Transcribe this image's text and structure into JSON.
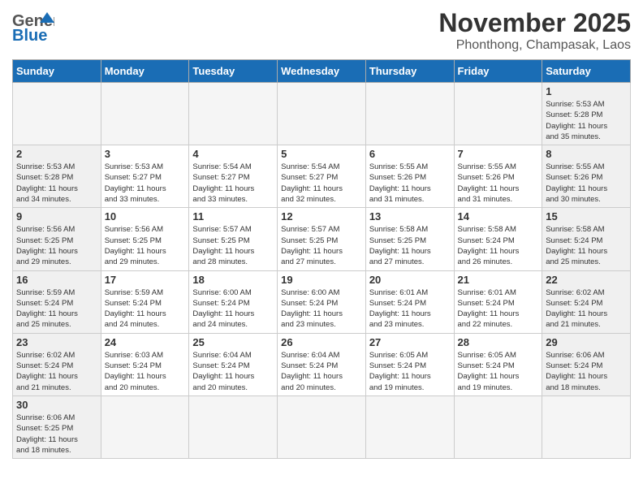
{
  "header": {
    "logo_general": "General",
    "logo_blue": "Blue",
    "month_title": "November 2025",
    "location": "Phonthong, Champasak, Laos"
  },
  "days_of_week": [
    "Sunday",
    "Monday",
    "Tuesday",
    "Wednesday",
    "Thursday",
    "Friday",
    "Saturday"
  ],
  "weeks": [
    [
      {
        "day": "",
        "info": "",
        "type": "empty"
      },
      {
        "day": "",
        "info": "",
        "type": "empty"
      },
      {
        "day": "",
        "info": "",
        "type": "empty"
      },
      {
        "day": "",
        "info": "",
        "type": "empty"
      },
      {
        "day": "",
        "info": "",
        "type": "empty"
      },
      {
        "day": "",
        "info": "",
        "type": "empty"
      },
      {
        "day": "1",
        "info": "Sunrise: 5:53 AM\nSunset: 5:28 PM\nDaylight: 11 hours\nand 35 minutes.",
        "type": "weekend"
      }
    ],
    [
      {
        "day": "2",
        "info": "Sunrise: 5:53 AM\nSunset: 5:28 PM\nDaylight: 11 hours\nand 34 minutes.",
        "type": "weekend"
      },
      {
        "day": "3",
        "info": "Sunrise: 5:53 AM\nSunset: 5:27 PM\nDaylight: 11 hours\nand 33 minutes.",
        "type": "weekday"
      },
      {
        "day": "4",
        "info": "Sunrise: 5:54 AM\nSunset: 5:27 PM\nDaylight: 11 hours\nand 33 minutes.",
        "type": "weekday"
      },
      {
        "day": "5",
        "info": "Sunrise: 5:54 AM\nSunset: 5:27 PM\nDaylight: 11 hours\nand 32 minutes.",
        "type": "weekday"
      },
      {
        "day": "6",
        "info": "Sunrise: 5:55 AM\nSunset: 5:26 PM\nDaylight: 11 hours\nand 31 minutes.",
        "type": "weekday"
      },
      {
        "day": "7",
        "info": "Sunrise: 5:55 AM\nSunset: 5:26 PM\nDaylight: 11 hours\nand 31 minutes.",
        "type": "weekday"
      },
      {
        "day": "8",
        "info": "Sunrise: 5:55 AM\nSunset: 5:26 PM\nDaylight: 11 hours\nand 30 minutes.",
        "type": "weekend"
      }
    ],
    [
      {
        "day": "9",
        "info": "Sunrise: 5:56 AM\nSunset: 5:25 PM\nDaylight: 11 hours\nand 29 minutes.",
        "type": "weekend"
      },
      {
        "day": "10",
        "info": "Sunrise: 5:56 AM\nSunset: 5:25 PM\nDaylight: 11 hours\nand 29 minutes.",
        "type": "weekday"
      },
      {
        "day": "11",
        "info": "Sunrise: 5:57 AM\nSunset: 5:25 PM\nDaylight: 11 hours\nand 28 minutes.",
        "type": "weekday"
      },
      {
        "day": "12",
        "info": "Sunrise: 5:57 AM\nSunset: 5:25 PM\nDaylight: 11 hours\nand 27 minutes.",
        "type": "weekday"
      },
      {
        "day": "13",
        "info": "Sunrise: 5:58 AM\nSunset: 5:25 PM\nDaylight: 11 hours\nand 27 minutes.",
        "type": "weekday"
      },
      {
        "day": "14",
        "info": "Sunrise: 5:58 AM\nSunset: 5:24 PM\nDaylight: 11 hours\nand 26 minutes.",
        "type": "weekday"
      },
      {
        "day": "15",
        "info": "Sunrise: 5:58 AM\nSunset: 5:24 PM\nDaylight: 11 hours\nand 25 minutes.",
        "type": "weekend"
      }
    ],
    [
      {
        "day": "16",
        "info": "Sunrise: 5:59 AM\nSunset: 5:24 PM\nDaylight: 11 hours\nand 25 minutes.",
        "type": "weekend"
      },
      {
        "day": "17",
        "info": "Sunrise: 5:59 AM\nSunset: 5:24 PM\nDaylight: 11 hours\nand 24 minutes.",
        "type": "weekday"
      },
      {
        "day": "18",
        "info": "Sunrise: 6:00 AM\nSunset: 5:24 PM\nDaylight: 11 hours\nand 24 minutes.",
        "type": "weekday"
      },
      {
        "day": "19",
        "info": "Sunrise: 6:00 AM\nSunset: 5:24 PM\nDaylight: 11 hours\nand 23 minutes.",
        "type": "weekday"
      },
      {
        "day": "20",
        "info": "Sunrise: 6:01 AM\nSunset: 5:24 PM\nDaylight: 11 hours\nand 23 minutes.",
        "type": "weekday"
      },
      {
        "day": "21",
        "info": "Sunrise: 6:01 AM\nSunset: 5:24 PM\nDaylight: 11 hours\nand 22 minutes.",
        "type": "weekday"
      },
      {
        "day": "22",
        "info": "Sunrise: 6:02 AM\nSunset: 5:24 PM\nDaylight: 11 hours\nand 21 minutes.",
        "type": "weekend"
      }
    ],
    [
      {
        "day": "23",
        "info": "Sunrise: 6:02 AM\nSunset: 5:24 PM\nDaylight: 11 hours\nand 21 minutes.",
        "type": "weekend"
      },
      {
        "day": "24",
        "info": "Sunrise: 6:03 AM\nSunset: 5:24 PM\nDaylight: 11 hours\nand 20 minutes.",
        "type": "weekday"
      },
      {
        "day": "25",
        "info": "Sunrise: 6:04 AM\nSunset: 5:24 PM\nDaylight: 11 hours\nand 20 minutes.",
        "type": "weekday"
      },
      {
        "day": "26",
        "info": "Sunrise: 6:04 AM\nSunset: 5:24 PM\nDaylight: 11 hours\nand 20 minutes.",
        "type": "weekday"
      },
      {
        "day": "27",
        "info": "Sunrise: 6:05 AM\nSunset: 5:24 PM\nDaylight: 11 hours\nand 19 minutes.",
        "type": "weekday"
      },
      {
        "day": "28",
        "info": "Sunrise: 6:05 AM\nSunset: 5:24 PM\nDaylight: 11 hours\nand 19 minutes.",
        "type": "weekday"
      },
      {
        "day": "29",
        "info": "Sunrise: 6:06 AM\nSunset: 5:24 PM\nDaylight: 11 hours\nand 18 minutes.",
        "type": "weekend"
      }
    ],
    [
      {
        "day": "30",
        "info": "Sunrise: 6:06 AM\nSunset: 5:25 PM\nDaylight: 11 hours\nand 18 minutes.",
        "type": "weekend"
      },
      {
        "day": "",
        "info": "",
        "type": "empty"
      },
      {
        "day": "",
        "info": "",
        "type": "empty"
      },
      {
        "day": "",
        "info": "",
        "type": "empty"
      },
      {
        "day": "",
        "info": "",
        "type": "empty"
      },
      {
        "day": "",
        "info": "",
        "type": "empty"
      },
      {
        "day": "",
        "info": "",
        "type": "empty"
      }
    ]
  ]
}
